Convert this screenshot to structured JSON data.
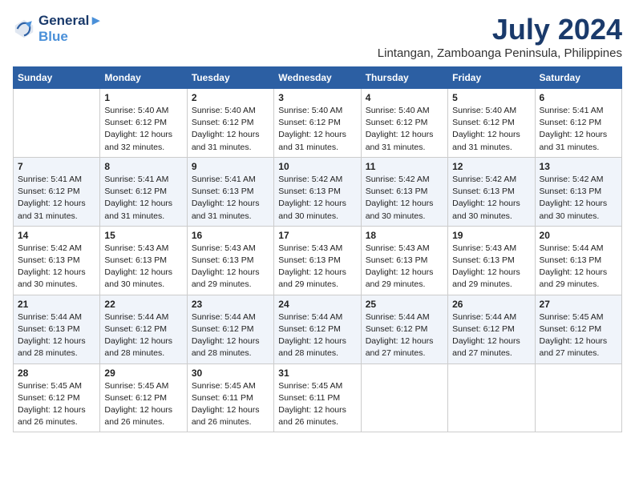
{
  "logo": {
    "line1": "General",
    "line2": "Blue"
  },
  "title": "July 2024",
  "subtitle": "Lintangan, Zamboanga Peninsula, Philippines",
  "days_of_week": [
    "Sunday",
    "Monday",
    "Tuesday",
    "Wednesday",
    "Thursday",
    "Friday",
    "Saturday"
  ],
  "weeks": [
    [
      {
        "day": "",
        "info": ""
      },
      {
        "day": "1",
        "info": "Sunrise: 5:40 AM\nSunset: 6:12 PM\nDaylight: 12 hours\nand 32 minutes."
      },
      {
        "day": "2",
        "info": "Sunrise: 5:40 AM\nSunset: 6:12 PM\nDaylight: 12 hours\nand 31 minutes."
      },
      {
        "day": "3",
        "info": "Sunrise: 5:40 AM\nSunset: 6:12 PM\nDaylight: 12 hours\nand 31 minutes."
      },
      {
        "day": "4",
        "info": "Sunrise: 5:40 AM\nSunset: 6:12 PM\nDaylight: 12 hours\nand 31 minutes."
      },
      {
        "day": "5",
        "info": "Sunrise: 5:40 AM\nSunset: 6:12 PM\nDaylight: 12 hours\nand 31 minutes."
      },
      {
        "day": "6",
        "info": "Sunrise: 5:41 AM\nSunset: 6:12 PM\nDaylight: 12 hours\nand 31 minutes."
      }
    ],
    [
      {
        "day": "7",
        "info": "Sunrise: 5:41 AM\nSunset: 6:12 PM\nDaylight: 12 hours\nand 31 minutes."
      },
      {
        "day": "8",
        "info": "Sunrise: 5:41 AM\nSunset: 6:12 PM\nDaylight: 12 hours\nand 31 minutes."
      },
      {
        "day": "9",
        "info": "Sunrise: 5:41 AM\nSunset: 6:13 PM\nDaylight: 12 hours\nand 31 minutes."
      },
      {
        "day": "10",
        "info": "Sunrise: 5:42 AM\nSunset: 6:13 PM\nDaylight: 12 hours\nand 30 minutes."
      },
      {
        "day": "11",
        "info": "Sunrise: 5:42 AM\nSunset: 6:13 PM\nDaylight: 12 hours\nand 30 minutes."
      },
      {
        "day": "12",
        "info": "Sunrise: 5:42 AM\nSunset: 6:13 PM\nDaylight: 12 hours\nand 30 minutes."
      },
      {
        "day": "13",
        "info": "Sunrise: 5:42 AM\nSunset: 6:13 PM\nDaylight: 12 hours\nand 30 minutes."
      }
    ],
    [
      {
        "day": "14",
        "info": "Sunrise: 5:42 AM\nSunset: 6:13 PM\nDaylight: 12 hours\nand 30 minutes."
      },
      {
        "day": "15",
        "info": "Sunrise: 5:43 AM\nSunset: 6:13 PM\nDaylight: 12 hours\nand 30 minutes."
      },
      {
        "day": "16",
        "info": "Sunrise: 5:43 AM\nSunset: 6:13 PM\nDaylight: 12 hours\nand 29 minutes."
      },
      {
        "day": "17",
        "info": "Sunrise: 5:43 AM\nSunset: 6:13 PM\nDaylight: 12 hours\nand 29 minutes."
      },
      {
        "day": "18",
        "info": "Sunrise: 5:43 AM\nSunset: 6:13 PM\nDaylight: 12 hours\nand 29 minutes."
      },
      {
        "day": "19",
        "info": "Sunrise: 5:43 AM\nSunset: 6:13 PM\nDaylight: 12 hours\nand 29 minutes."
      },
      {
        "day": "20",
        "info": "Sunrise: 5:44 AM\nSunset: 6:13 PM\nDaylight: 12 hours\nand 29 minutes."
      }
    ],
    [
      {
        "day": "21",
        "info": "Sunrise: 5:44 AM\nSunset: 6:13 PM\nDaylight: 12 hours\nand 28 minutes."
      },
      {
        "day": "22",
        "info": "Sunrise: 5:44 AM\nSunset: 6:12 PM\nDaylight: 12 hours\nand 28 minutes."
      },
      {
        "day": "23",
        "info": "Sunrise: 5:44 AM\nSunset: 6:12 PM\nDaylight: 12 hours\nand 28 minutes."
      },
      {
        "day": "24",
        "info": "Sunrise: 5:44 AM\nSunset: 6:12 PM\nDaylight: 12 hours\nand 28 minutes."
      },
      {
        "day": "25",
        "info": "Sunrise: 5:44 AM\nSunset: 6:12 PM\nDaylight: 12 hours\nand 27 minutes."
      },
      {
        "day": "26",
        "info": "Sunrise: 5:44 AM\nSunset: 6:12 PM\nDaylight: 12 hours\nand 27 minutes."
      },
      {
        "day": "27",
        "info": "Sunrise: 5:45 AM\nSunset: 6:12 PM\nDaylight: 12 hours\nand 27 minutes."
      }
    ],
    [
      {
        "day": "28",
        "info": "Sunrise: 5:45 AM\nSunset: 6:12 PM\nDaylight: 12 hours\nand 26 minutes."
      },
      {
        "day": "29",
        "info": "Sunrise: 5:45 AM\nSunset: 6:12 PM\nDaylight: 12 hours\nand 26 minutes."
      },
      {
        "day": "30",
        "info": "Sunrise: 5:45 AM\nSunset: 6:11 PM\nDaylight: 12 hours\nand 26 minutes."
      },
      {
        "day": "31",
        "info": "Sunrise: 5:45 AM\nSunset: 6:11 PM\nDaylight: 12 hours\nand 26 minutes."
      },
      {
        "day": "",
        "info": ""
      },
      {
        "day": "",
        "info": ""
      },
      {
        "day": "",
        "info": ""
      }
    ]
  ]
}
